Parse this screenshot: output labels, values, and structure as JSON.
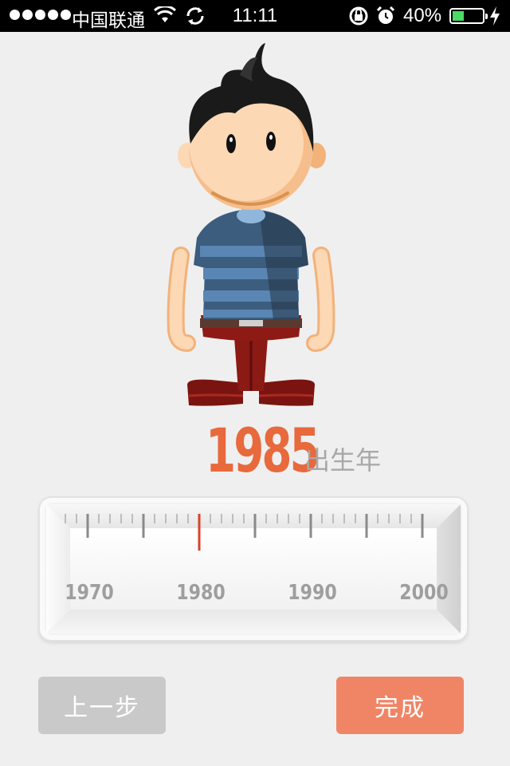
{
  "status_bar": {
    "carrier": "中国联通",
    "time": "11:11",
    "battery_percent": "40%",
    "battery_level": 0.4
  },
  "year": {
    "value": "1985",
    "suffix": "出生年",
    "color": "#e8693c"
  },
  "ruler": {
    "labels": [
      "1970",
      "1980",
      "1990",
      "2000"
    ],
    "start": 1968,
    "end": 2000,
    "selected": 1980,
    "indicator_color": "#d8432a"
  },
  "buttons": {
    "prev_label": "上一步",
    "done_label": "完成",
    "done_color": "#f08566"
  }
}
